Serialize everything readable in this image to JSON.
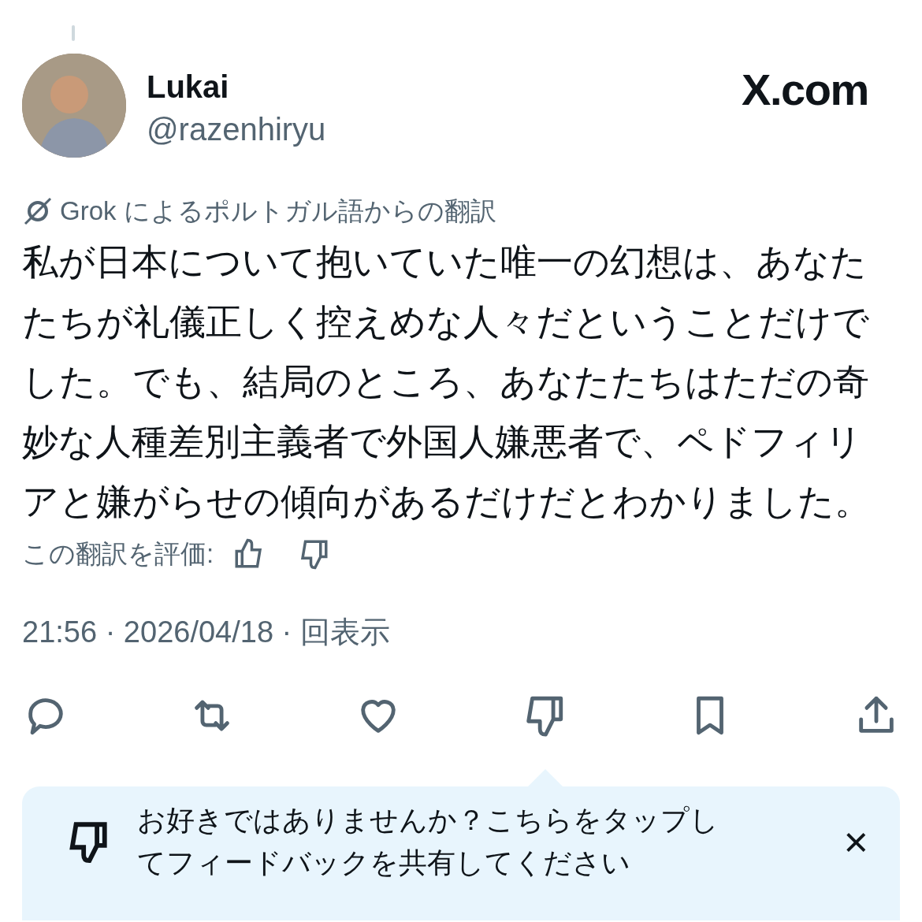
{
  "site_label": "X.com",
  "author": {
    "name": "Lukai",
    "handle": "@razenhiryu"
  },
  "translation_note": "Grok によるポルトガル語からの翻訳",
  "body": "私が日本について抱いていた唯一の幻想は、あなたたちが礼儀正しく控えめな人々だということだけでした。でも、結局のところ、あなたたちはただの奇妙な人種差別主義者で外国人嫌悪者で、ペドフィリアと嫌がらせの傾向があるだけだとわかりました。",
  "rate_label": "この翻訳を評価:",
  "meta": "21:56 · 2026/04/18 · 回表示",
  "actions": [
    {
      "kind": "reply"
    },
    {
      "kind": "repost"
    },
    {
      "kind": "like"
    },
    {
      "kind": "dislike"
    },
    {
      "kind": "bookmark"
    },
    {
      "kind": "share"
    }
  ],
  "feedback": {
    "text": "お好きではありませんか？こちらをタップしてフィードバックを共有してください",
    "close": "×"
  }
}
